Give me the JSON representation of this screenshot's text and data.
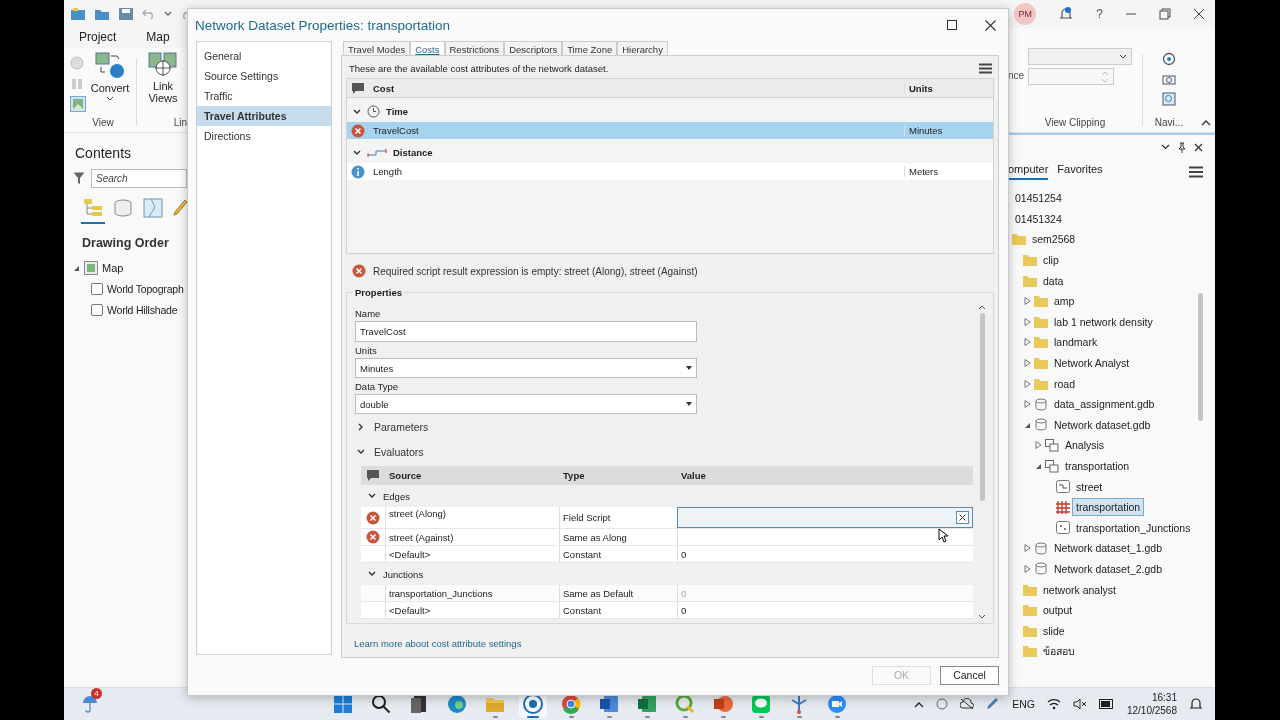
{
  "titlebar": {
    "account": "PM",
    "help": "?"
  },
  "ribbon": {
    "tabs": [
      {
        "label": "Project",
        "selected": false
      },
      {
        "label": "Map",
        "selected": false
      }
    ],
    "groups": [
      {
        "label": "View",
        "button": "Convert"
      },
      {
        "label": "Lin",
        "button": "Link Views"
      }
    ],
    "right": {
      "field_label": "nce",
      "groups": [
        "View Clipping",
        "Navi..."
      ]
    }
  },
  "contents": {
    "title": "Contents",
    "search": {
      "placeholder": "Search"
    },
    "views": [
      {
        "kind": "order",
        "selected": true
      },
      {
        "kind": "source",
        "selected": false
      },
      {
        "kind": "selection",
        "selected": false
      },
      {
        "kind": "edit",
        "selected": false
      }
    ],
    "heading": "Drawing Order",
    "layers": [
      {
        "label": "Map",
        "expanded": true,
        "children": [
          {
            "label": "World Topograph",
            "checked": false
          },
          {
            "label": "World Hillshade",
            "checked": false
          }
        ]
      }
    ]
  },
  "catalog": {
    "tabs": [
      {
        "label": "omputer",
        "selected": true
      },
      {
        "label": "Favorites",
        "selected": false
      }
    ],
    "tree": [
      {
        "label": "01451254",
        "kind": "none",
        "selected": false
      },
      {
        "label": "01451324",
        "kind": "none",
        "selected": false
      },
      {
        "label": "sem2568",
        "kind": "folder",
        "selected": false,
        "children": [
          {
            "label": "clip",
            "kind": "folder",
            "selected": false
          },
          {
            "label": "data",
            "kind": "folder",
            "selected": false,
            "children": [
              {
                "label": "amp",
                "kind": "folder",
                "expanded": false,
                "selected": false
              },
              {
                "label": "lab 1 network density",
                "kind": "folder",
                "expanded": false,
                "selected": false
              },
              {
                "label": "landmark",
                "kind": "folder",
                "expanded": false,
                "selected": false
              },
              {
                "label": "Network Analyst",
                "kind": "folder",
                "expanded": false,
                "selected": false
              },
              {
                "label": "road",
                "kind": "folder",
                "expanded": false,
                "selected": false
              },
              {
                "label": "data_assignment.gdb",
                "kind": "database",
                "expanded": false,
                "selected": false
              },
              {
                "label": "Network dataset.gdb",
                "kind": "database",
                "expanded": true,
                "selected": false,
                "children": [
                  {
                    "label": "Analysis",
                    "kind": "dataset",
                    "expanded": false,
                    "selected": false
                  },
                  {
                    "label": "transportation",
                    "kind": "dataset",
                    "expanded": true,
                    "selected": false,
                    "children": [
                      {
                        "label": "street",
                        "kind": "line",
                        "selected": false
                      },
                      {
                        "label": "transportation",
                        "kind": "network",
                        "selected": true
                      },
                      {
                        "label": "transportation_Junctions",
                        "kind": "point",
                        "selected": false
                      }
                    ]
                  }
                ]
              },
              {
                "label": "Network dataset_1.gdb",
                "kind": "database",
                "expanded": false,
                "selected": false
              },
              {
                "label": "Network dataset_2.gdb",
                "kind": "database",
                "expanded": false,
                "selected": false
              }
            ]
          },
          {
            "label": "network analyst",
            "kind": "folder",
            "selected": false
          },
          {
            "label": "output",
            "kind": "folder",
            "selected": false
          },
          {
            "label": "slide",
            "kind": "folder",
            "selected": false
          },
          {
            "label": "ข้อสอบ",
            "kind": "folder",
            "selected": false
          }
        ]
      }
    ]
  },
  "dialog": {
    "title": "Network Dataset Properties: transportation",
    "nav": [
      {
        "label": "General",
        "selected": false
      },
      {
        "label": "Source Settings",
        "selected": false
      },
      {
        "label": "Traffic",
        "selected": false
      },
      {
        "label": "Travel Attributes",
        "selected": true
      },
      {
        "label": "Directions",
        "selected": false
      }
    ],
    "tabs": [
      {
        "label": "Travel Modes",
        "selected": false
      },
      {
        "label": "Costs",
        "selected": true
      },
      {
        "label": "Restrictions",
        "selected": false
      },
      {
        "label": "Descriptors",
        "selected": false
      },
      {
        "label": "Time Zone",
        "selected": false
      },
      {
        "label": "Hierarchy",
        "selected": false
      }
    ],
    "description": "These are the available cost attributes of the network dataset.",
    "cost_table": {
      "columns": [
        "Cost",
        "Units"
      ],
      "groups": [
        {
          "label": "Time",
          "kind": "time",
          "expanded": true,
          "rows": [
            {
              "name": "TravelCost",
              "units": "Minutes",
              "kind": "error",
              "selected": true
            }
          ]
        },
        {
          "label": "Distance",
          "kind": "distance",
          "expanded": true,
          "rows": [
            {
              "name": "Length",
              "units": "Meters",
              "kind": "info",
              "selected": false
            }
          ]
        }
      ]
    },
    "error": "Required script result expression is empty: street (Along), street (Against)",
    "properties": {
      "title": "Properties",
      "name_label": "Name",
      "name_value": "TravelCost",
      "units_label": "Units",
      "units_value": "Minutes",
      "type_label": "Data Type",
      "type_value": "double",
      "sections": [
        {
          "label": "Parameters",
          "expanded": false
        },
        {
          "label": "Evaluators",
          "expanded": true
        }
      ],
      "evaluators": {
        "columns": [
          "Source",
          "Type",
          "Value"
        ],
        "groups": [
          {
            "label": "Edges",
            "expanded": true,
            "rows": [
              {
                "source": "street (Along)",
                "type": "Field Script",
                "error": true,
                "editing": true,
                "disabled": false
              },
              {
                "source": "street (Against)",
                "type": "Same as Along",
                "error": true,
                "editing": false,
                "disabled": false
              },
              {
                "source": "<Default>",
                "type": "Constant",
                "value": "0",
                "error": false,
                "editing": false,
                "disabled": false
              }
            ]
          },
          {
            "label": "Junctions",
            "expanded": true,
            "rows": [
              {
                "source": "transportation_Junctions",
                "type": "Same as Default",
                "value": "0",
                "error": false,
                "editing": false,
                "disabled": true
              },
              {
                "source": "<Default>",
                "type": "Constant",
                "value": "0",
                "error": false,
                "editing": false,
                "disabled": false
              }
            ]
          }
        ]
      }
    },
    "link": "Learn more about cost attribute settings",
    "buttons": [
      {
        "label": "OK",
        "disabled": true
      },
      {
        "label": "Cancel",
        "disabled": false
      }
    ]
  },
  "taskbar": {
    "badge": "4",
    "language": "ENG",
    "time": "16:31",
    "date": "12/10/2568",
    "apps": [
      {
        "kind": "start",
        "running": false,
        "active": false
      },
      {
        "kind": "search",
        "running": false,
        "active": false
      },
      {
        "kind": "taskview",
        "running": false,
        "active": false
      },
      {
        "kind": "edge",
        "running": false,
        "active": false
      },
      {
        "kind": "explorer",
        "running": true,
        "active": false
      },
      {
        "kind": "globe",
        "running": true,
        "active": true
      },
      {
        "kind": "chrome",
        "running": true,
        "active": false
      },
      {
        "kind": "word",
        "running": true,
        "active": false
      },
      {
        "kind": "excel",
        "running": true,
        "active": false
      },
      {
        "kind": "qgis",
        "running": true,
        "active": false
      },
      {
        "kind": "powerpoint",
        "running": true,
        "active": false
      },
      {
        "kind": "line",
        "running": true,
        "active": false
      },
      {
        "kind": "network",
        "running": true,
        "active": false
      },
      {
        "kind": "video",
        "running": true,
        "active": false
      }
    ]
  }
}
